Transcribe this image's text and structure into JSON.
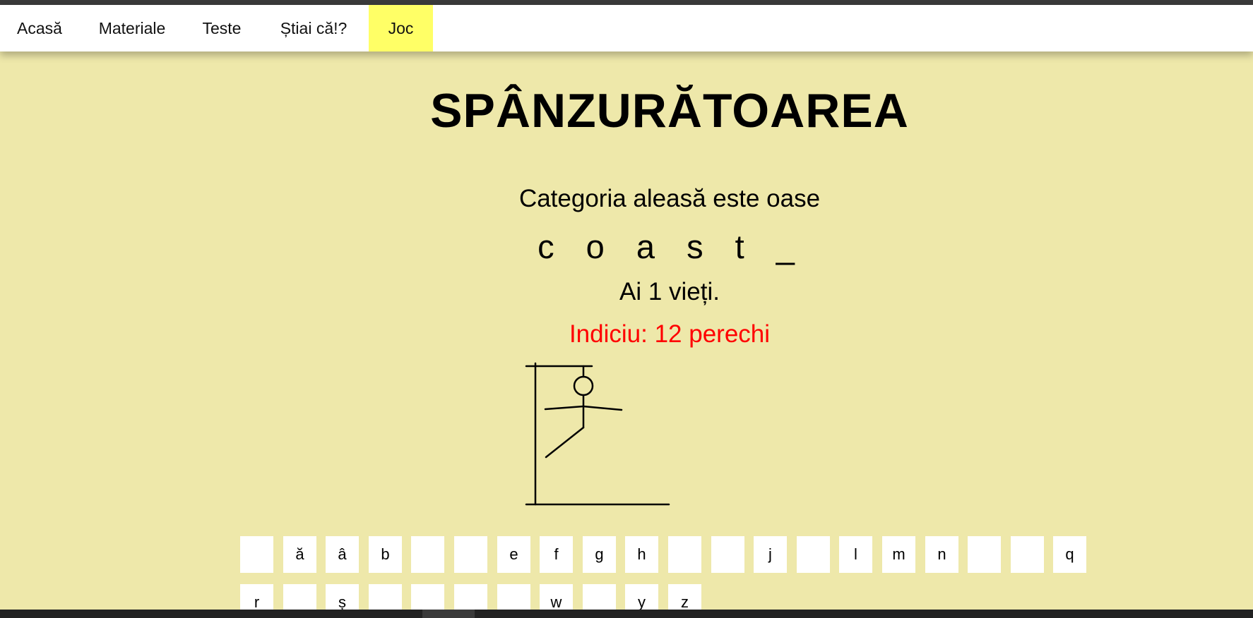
{
  "nav": {
    "items": [
      {
        "label": "Acasă",
        "active": false
      },
      {
        "label": "Materiale",
        "active": false
      },
      {
        "label": "Teste",
        "active": false
      },
      {
        "label": "Știai că!?",
        "active": false
      },
      {
        "label": "Joc",
        "active": true
      }
    ],
    "active_color": "#ffff66"
  },
  "game": {
    "title": "SPÂNZURĂTOAREA",
    "category_text": "Categoria aleasă este oase",
    "word": [
      "c",
      "o",
      "a",
      "s",
      "t",
      "_"
    ],
    "lives_text": "Ai 1 vieți.",
    "hint_text": "Indiciu: 12 perechi",
    "hint_color": "#ff0000",
    "lives_remaining": 1
  },
  "keyboard": {
    "row1": [
      "",
      "ă",
      "â",
      "b",
      "",
      "",
      "e",
      "f",
      "g",
      "h",
      "",
      "",
      "j",
      "",
      "l",
      "m",
      "n",
      "",
      "",
      "q"
    ],
    "row2": [
      "r",
      "",
      "ș",
      "",
      "",
      "",
      "",
      "w",
      "",
      "y",
      "z"
    ]
  },
  "colors": {
    "background": "#eee8aa",
    "navbar": "#ffffff",
    "key": "#ffffff"
  }
}
